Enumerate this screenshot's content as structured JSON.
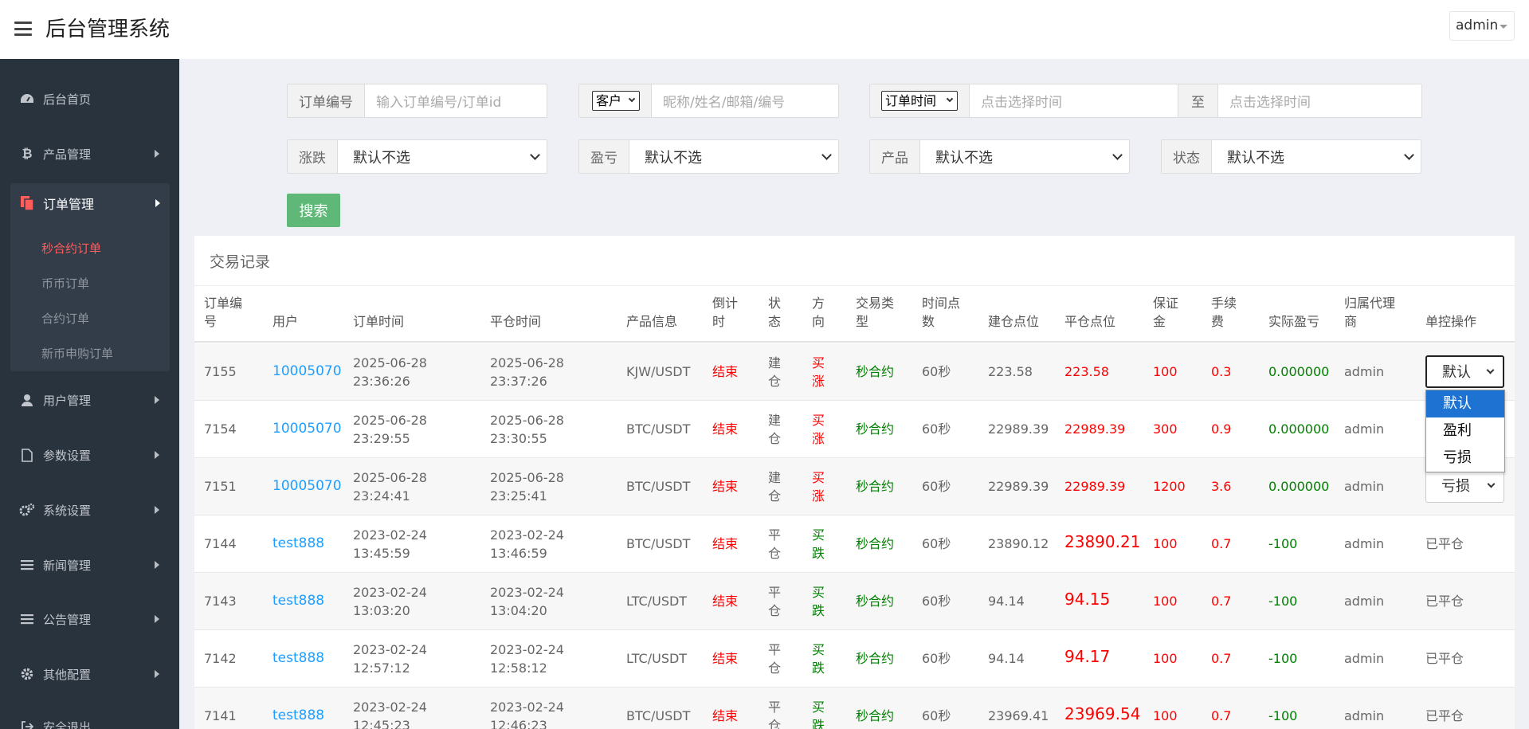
{
  "header": {
    "title": "后台管理系统",
    "user": "admin"
  },
  "sidebar": {
    "items": [
      {
        "label": "后台首页",
        "icon": "dashboard-icon"
      },
      {
        "label": "产品管理",
        "icon": "bitcoin-icon"
      },
      {
        "label": "订单管理",
        "icon": "copy-icon"
      },
      {
        "label": "用户管理",
        "icon": "user-icon"
      },
      {
        "label": "参数设置",
        "icon": "file-icon"
      },
      {
        "label": "系统设置",
        "icon": "cogs-icon"
      },
      {
        "label": "新闻管理",
        "icon": "list-icon"
      },
      {
        "label": "公告管理",
        "icon": "list-icon"
      },
      {
        "label": "其他配置",
        "icon": "gear-icon"
      },
      {
        "label": "安全退出",
        "icon": "logout-icon"
      }
    ],
    "subitems": [
      "秒合约订单",
      "币币订单",
      "合约订单",
      "新币申购订单"
    ],
    "active_color": "#ff5c5c"
  },
  "filters": {
    "order_no_label": "订单编号",
    "order_no_placeholder": "输入订单编号/订单id",
    "customer_select": "客户",
    "customer_placeholder": "昵称/姓名/邮箱/编号",
    "time_select": "订单时间",
    "time_start_placeholder": "点击选择时间",
    "to_label": "至",
    "time_end_placeholder": "点击选择时间",
    "updown_label": "涨跌",
    "updown_value": "默认不选",
    "profit_label": "盈亏",
    "profit_value": "默认不选",
    "product_label": "产品",
    "product_value": "默认不选",
    "status_label": "状态",
    "status_value": "默认不选",
    "search_label": "搜索"
  },
  "panel": {
    "title": "交易记录",
    "headers": {
      "id": [
        "订单编",
        "号"
      ],
      "user": "用户",
      "order_time": "订单时间",
      "close_time": "平仓时间",
      "product": "产品信息",
      "countdown": [
        "倒计",
        "时"
      ],
      "status": [
        "状",
        "态"
      ],
      "direction": [
        "方",
        "向"
      ],
      "trade_type": [
        "交易类",
        "型"
      ],
      "time_points": [
        "时间点",
        "数"
      ],
      "open_price": "建仓点位",
      "close_price": "平仓点位",
      "margin": [
        "保证",
        "金"
      ],
      "fee": [
        "手续",
        "费"
      ],
      "pnl": "实际盈亏",
      "agent": [
        "归属代理",
        "商"
      ],
      "control": "单控操作"
    },
    "rows": [
      {
        "id": "7155",
        "user": "10005070",
        "order_date": "2025-06-28",
        "order_clock": "23:36:26",
        "close_date": "2025-06-28",
        "close_clock": "23:37:26",
        "product": "KJW/USDT",
        "countdown": "结束",
        "status": [
          "建",
          "仓"
        ],
        "direction": [
          "买",
          "涨"
        ],
        "trade_type": "秒合约",
        "time_points": "60秒",
        "open_price": "223.58",
        "close_price": "223.58",
        "margin": "100",
        "fee": "0.3",
        "pnl": "0.000000",
        "agent": "admin",
        "control": "默认"
      },
      {
        "id": "7154",
        "user": "10005070",
        "order_date": "2025-06-28",
        "order_clock": "23:29:55",
        "close_date": "2025-06-28",
        "close_clock": "23:30:55",
        "product": "BTC/USDT",
        "countdown": "结束",
        "status": [
          "建",
          "仓"
        ],
        "direction": [
          "买",
          "涨"
        ],
        "trade_type": "秒合约",
        "time_points": "60秒",
        "open_price": "22989.39",
        "close_price": "22989.39",
        "margin": "300",
        "fee": "0.9",
        "pnl": "0.000000",
        "agent": "admin",
        "control": ""
      },
      {
        "id": "7151",
        "user": "10005070",
        "order_date": "2025-06-28",
        "order_clock": "23:24:41",
        "close_date": "2025-06-28",
        "close_clock": "23:25:41",
        "product": "BTC/USDT",
        "countdown": "结束",
        "status": [
          "建",
          "仓"
        ],
        "direction": [
          "买",
          "涨"
        ],
        "trade_type": "秒合约",
        "time_points": "60秒",
        "open_price": "22989.39",
        "close_price": "22989.39",
        "margin": "1200",
        "fee": "3.6",
        "pnl": "0.000000",
        "agent": "admin",
        "control": "亏损"
      },
      {
        "id": "7144",
        "user": "test888",
        "order_date": "2023-02-24",
        "order_clock": "13:45:59",
        "close_date": "2023-02-24",
        "close_clock": "13:46:59",
        "product": "BTC/USDT",
        "countdown": "结束",
        "status": [
          "平",
          "仓"
        ],
        "direction": [
          "买",
          "跌"
        ],
        "trade_type": "秒合约",
        "time_points": "60秒",
        "open_price": "23890.12",
        "close_price": "23890.21",
        "margin": "100",
        "fee": "0.7",
        "pnl": "-100",
        "agent": "admin",
        "control": "已平仓"
      },
      {
        "id": "7143",
        "user": "test888",
        "order_date": "2023-02-24",
        "order_clock": "13:03:20",
        "close_date": "2023-02-24",
        "close_clock": "13:04:20",
        "product": "LTC/USDT",
        "countdown": "结束",
        "status": [
          "平",
          "仓"
        ],
        "direction": [
          "买",
          "跌"
        ],
        "trade_type": "秒合约",
        "time_points": "60秒",
        "open_price": "94.14",
        "close_price": "94.15",
        "margin": "100",
        "fee": "0.7",
        "pnl": "-100",
        "agent": "admin",
        "control": "已平仓"
      },
      {
        "id": "7142",
        "user": "test888",
        "order_date": "2023-02-24",
        "order_clock": "12:57:12",
        "close_date": "2023-02-24",
        "close_clock": "12:58:12",
        "product": "LTC/USDT",
        "countdown": "结束",
        "status": [
          "平",
          "仓"
        ],
        "direction": [
          "买",
          "跌"
        ],
        "trade_type": "秒合约",
        "time_points": "60秒",
        "open_price": "94.14",
        "close_price": "94.17",
        "margin": "100",
        "fee": "0.7",
        "pnl": "-100",
        "agent": "admin",
        "control": "已平仓"
      },
      {
        "id": "7141",
        "user": "test888",
        "order_date": "2023-02-24",
        "order_clock": "12:45:23",
        "close_date": "2023-02-24",
        "close_clock": "12:46:23",
        "product": "BTC/USDT",
        "countdown": "结束",
        "status": [
          "平",
          "仓"
        ],
        "direction": [
          "买",
          "跌"
        ],
        "trade_type": "秒合约",
        "time_points": "60秒",
        "open_price": "23969.41",
        "close_price": "23969.54",
        "margin": "100",
        "fee": "0.7",
        "pnl": "-100",
        "agent": "admin",
        "control": "已平仓"
      }
    ]
  },
  "dropdown": {
    "options": [
      "默认",
      "盈利",
      "亏损"
    ],
    "highlighted": "默认"
  },
  "colors": {
    "link": "#1e9fff",
    "loss": "#ff0000",
    "gain": "#008000",
    "button": "#5fb878",
    "sidebar": "#28333e"
  }
}
